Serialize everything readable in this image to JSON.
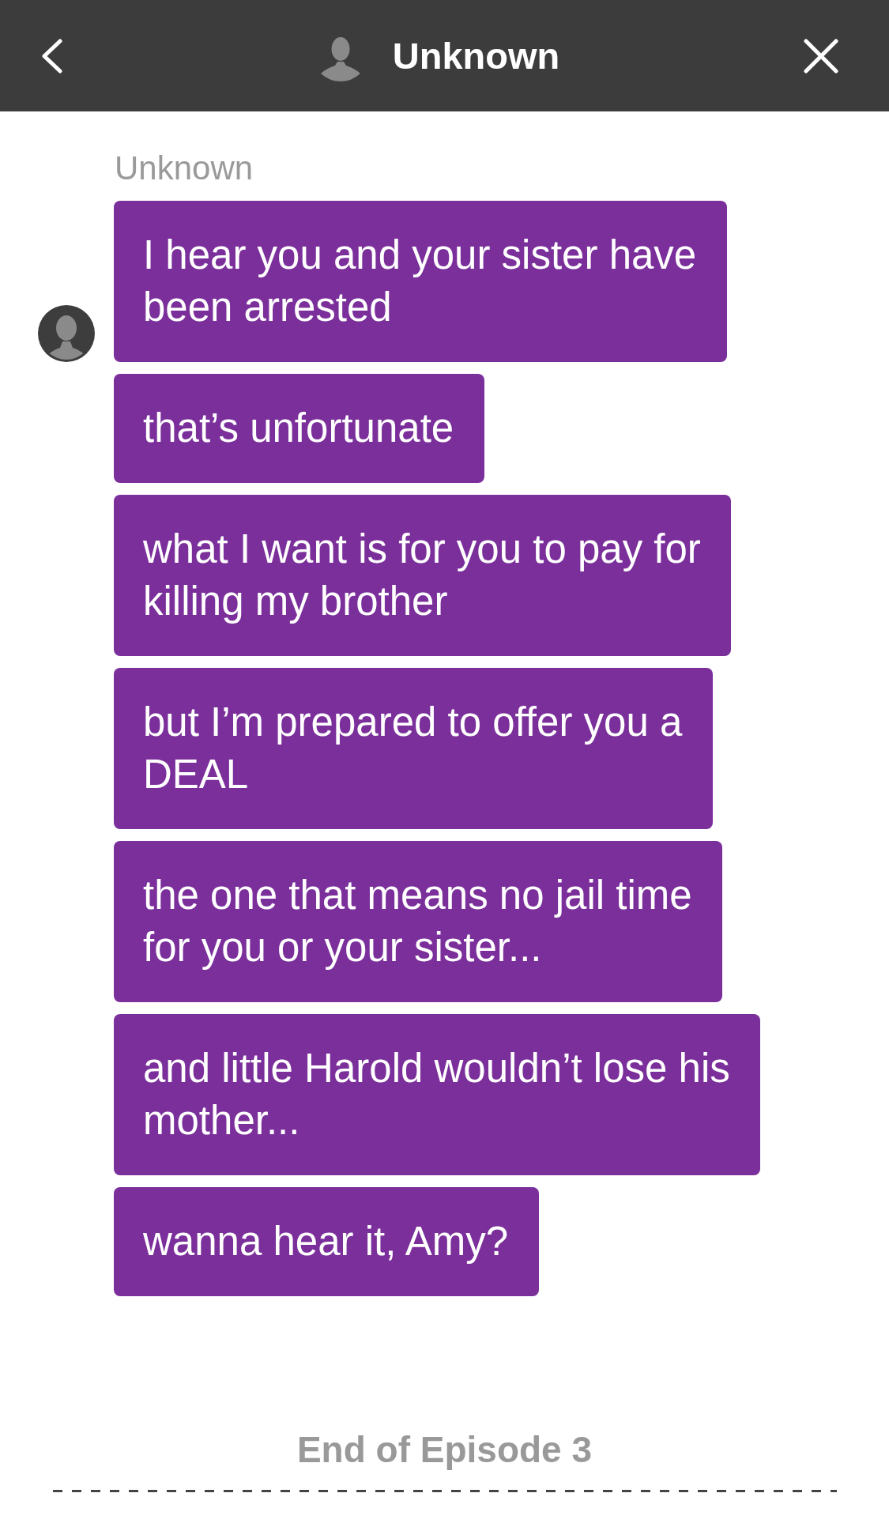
{
  "header": {
    "title": "Unknown"
  },
  "thread": {
    "sender": "Unknown",
    "messages": [
      {
        "text": "I hear you and your sister have been arrested",
        "avatar": true
      },
      {
        "text": "that’s unfortunate",
        "avatar": false
      },
      {
        "text": "what I want is for you to pay for killing my brother",
        "avatar": false
      },
      {
        "text": "but I’m prepared to offer you a DEAL",
        "avatar": false
      },
      {
        "text": "the one that means no jail time for you or your sister...",
        "avatar": false
      },
      {
        "text": "and little Harold wouldn’t lose his mother...",
        "avatar": false
      },
      {
        "text": "wanna hear it, Amy?",
        "avatar": false
      }
    ]
  },
  "footer": {
    "label": "End of Episode 3"
  }
}
